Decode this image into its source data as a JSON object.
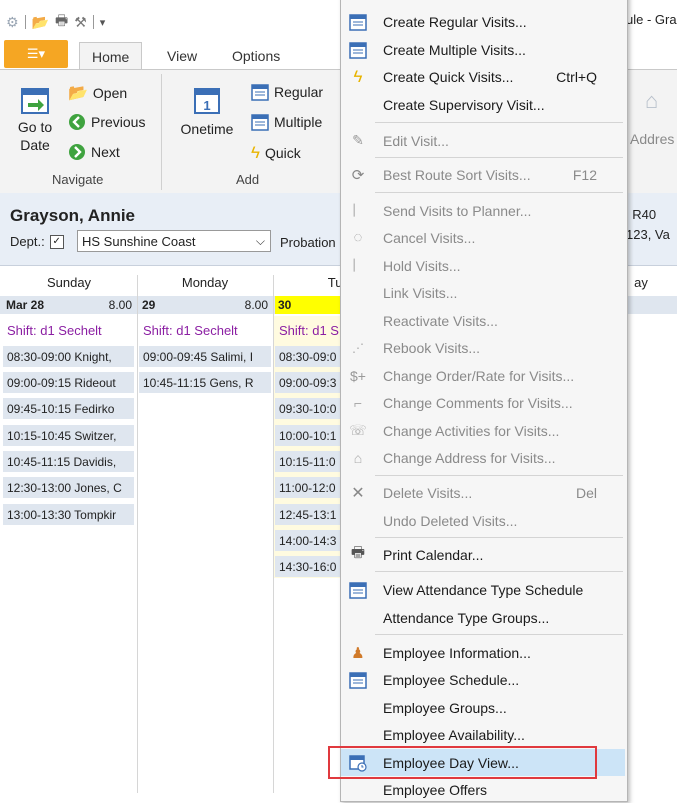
{
  "title_bar": {
    "title": "ule - Gra"
  },
  "ribbon": {
    "file_tab_icon": "ribbon-menu-icon",
    "tabs": [
      {
        "label": "Home"
      },
      {
        "label": "View"
      },
      {
        "label": "Options"
      }
    ],
    "navigate": {
      "label": "Navigate",
      "goto_date": "Go to\nDate",
      "open": "Open",
      "previous": "Previous",
      "next": "Next"
    },
    "add": {
      "label": "Add",
      "onetime": "Onetime",
      "regular": "Regular",
      "multiple": "Multiple",
      "quick": "Quick"
    },
    "address_label": "Addres"
  },
  "employee": {
    "name": "Grayson, Annie",
    "dept_label": "Dept.:",
    "dept_value": "HS Sunshine Coast",
    "probation_label": "Probation",
    "right_info_1": ":  R40",
    "right_info_2": "123, Va"
  },
  "calendar": {
    "days": [
      {
        "label": "Sunday"
      },
      {
        "label": "Monday"
      },
      {
        "label": "Tues"
      },
      {
        "label": "ay"
      }
    ],
    "dates": [
      {
        "date": "Mar 28",
        "hours": "8.00"
      },
      {
        "date": "29",
        "hours": "8.00"
      },
      {
        "date": "30",
        "hours": ""
      }
    ],
    "sunday": {
      "shift": "Shift: d1 Sechelt",
      "visits": [
        "08:30-09:00 Knight,",
        "09:00-09:15 Rideout",
        "09:45-10:15 Fedirko",
        "10:15-10:45 Switzer,",
        "10:45-11:15 Davidis,",
        "12:30-13:00 Jones, C",
        "13:00-13:30 Tompkir"
      ]
    },
    "monday": {
      "shift": "Shift: d1 Sechelt",
      "visits": [
        "09:00-09:45 Salimi, I",
        "10:45-11:15 Gens, R"
      ]
    },
    "tuesday": {
      "shift": "Shift: d1 S",
      "visits": [
        "08:30-09:0",
        "09:00-09:3",
        "09:30-10:0",
        "10:00-10:1",
        "10:15-11:0",
        "11:00-12:0",
        "12:45-13:1",
        "14:00-14:3",
        "14:30-16:0"
      ]
    }
  },
  "menu": {
    "items": [
      {
        "label": "Create Regular Visits...",
        "shortcut": "",
        "icon": "calendar-icon"
      },
      {
        "label": "Create Multiple Visits...",
        "shortcut": "",
        "icon": "calendar-icon"
      },
      {
        "label": "Create Quick Visits...",
        "shortcut": "Ctrl+Q",
        "icon": "lightning-icon"
      },
      {
        "label": "Create Supervisory Visit...",
        "shortcut": "",
        "icon": ""
      },
      {
        "label": "Edit Visit...",
        "shortcut": "",
        "icon": "pencil-icon"
      },
      {
        "label": "Best Route Sort Visits...",
        "shortcut": "F12",
        "icon": "route-icon"
      },
      {
        "label": "Send Visits to Planner...",
        "shortcut": "",
        "icon": "send-icon"
      },
      {
        "label": "Cancel Visits...",
        "shortcut": "",
        "icon": "cancel-icon"
      },
      {
        "label": "Hold Visits...",
        "shortcut": "",
        "icon": "hold-icon"
      },
      {
        "label": "Link Visits...",
        "shortcut": "",
        "icon": ""
      },
      {
        "label": "Reactivate Visits...",
        "shortcut": "",
        "icon": ""
      },
      {
        "label": "Rebook Visits...",
        "shortcut": "",
        "icon": "rebook-icon"
      },
      {
        "label": "Change Order/Rate for Visits...",
        "shortcut": "",
        "icon": "dollar-icon"
      },
      {
        "label": "Change Comments for Visits...",
        "shortcut": "",
        "icon": "comment-icon"
      },
      {
        "label": "Change Activities for Visits...",
        "shortcut": "",
        "icon": "activities-icon"
      },
      {
        "label": "Change Address for Visits...",
        "shortcut": "",
        "icon": "address-icon"
      },
      {
        "label": "Delete Visits...",
        "shortcut": "Del",
        "icon": "delete-icon"
      },
      {
        "label": "Undo Deleted Visits...",
        "shortcut": "",
        "icon": ""
      },
      {
        "label": "Print Calendar...",
        "shortcut": "",
        "icon": "printer-icon"
      },
      {
        "label": "View Attendance Type Schedule",
        "shortcut": "",
        "icon": "calendar-icon"
      },
      {
        "label": "Attendance Type Groups...",
        "shortcut": "",
        "icon": ""
      },
      {
        "label": "Employee Information...",
        "shortcut": "",
        "icon": "person-icon"
      },
      {
        "label": "Employee Schedule...",
        "shortcut": "",
        "icon": "calendar-icon"
      },
      {
        "label": "Employee Groups...",
        "shortcut": "",
        "icon": ""
      },
      {
        "label": "Employee Availability...",
        "shortcut": "",
        "icon": ""
      },
      {
        "label": "Employee Day View...",
        "shortcut": "",
        "icon": "day-view-icon"
      },
      {
        "label": "Employee Offers",
        "shortcut": "",
        "icon": ""
      }
    ]
  }
}
